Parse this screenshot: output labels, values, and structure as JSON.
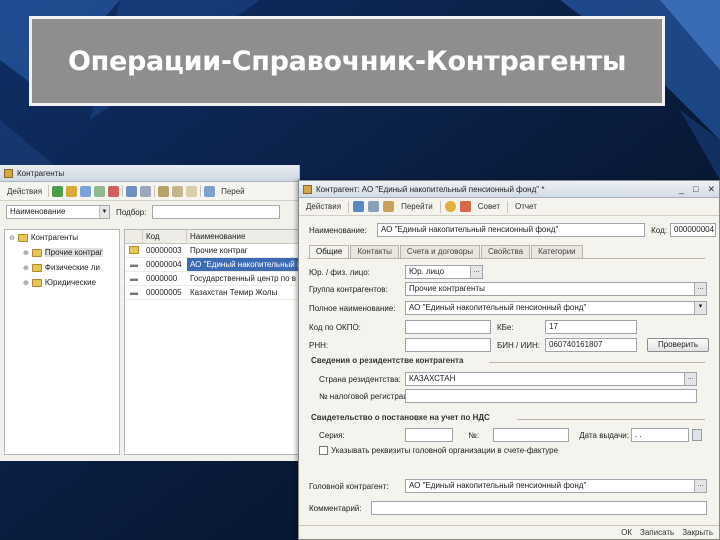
{
  "slide": {
    "title": "Операции-Справочник-Контрагенты"
  },
  "main_window": {
    "title": "Контрагенты",
    "toolbar": {
      "actions_label": "Действия",
      "goto_label": "Перей"
    },
    "filter": {
      "select_value": "Наименование",
      "label": "Подбор:"
    },
    "tree": {
      "items": [
        {
          "label": "Контрагенты"
        },
        {
          "label": "Прочие контраг"
        },
        {
          "label": "Физические ли"
        },
        {
          "label": "Юридические"
        }
      ]
    },
    "grid": {
      "headers": {
        "code": "Код",
        "name": "Наименование"
      },
      "rows": [
        {
          "code": "00000003",
          "name": "Прочие контраг"
        },
        {
          "code": "00000004",
          "name": "АО \"Единый накопительный пенсионный фонд\""
        },
        {
          "code": "0000000",
          "name": "Государственный центр по в"
        },
        {
          "code": "00000005",
          "name": "Казахстан Темир Жолы"
        }
      ]
    }
  },
  "dialog": {
    "title": "Контрагент: АО \"Единый накопительный пенсионный фонд\" *",
    "toolbar": {
      "actions_label": "Действия",
      "goto_label": "Перейти",
      "advice_label": "Совет",
      "report_label": "Отчет"
    },
    "name": {
      "label": "Наименование:",
      "value": "АО \"Единый накопительный пенсионный фонд\""
    },
    "code": {
      "label": "Код:",
      "value": "000000004"
    },
    "tabs": [
      "Общие",
      "Контакты",
      "Счета и договоры",
      "Свойства",
      "Категории"
    ],
    "fields": {
      "legal_type": {
        "label": "Юр. / физ. лицо:",
        "value": "Юр. лицо"
      },
      "group": {
        "label": "Группа контрагентов:",
        "value": "Прочие контрагенты"
      },
      "full_name": {
        "label": "Полное наименование:",
        "value": "АО \"Единый накопительный пенсионный фонд\""
      },
      "okpo": {
        "label": "Код по ОКПО:",
        "value": ""
      },
      "kbe": {
        "label": "КБе:",
        "value": "17"
      },
      "rnn": {
        "label": "РНН:",
        "value": ""
      },
      "bin": {
        "label": "БИН / ИИН:",
        "value": "060740161807"
      },
      "check_button": "Проверить",
      "residency_section": "Сведения о резидентстве контрагента",
      "country": {
        "label": "Страна резидентства:",
        "value": "КАЗАХСТАН"
      },
      "tax_reg": {
        "label": "№ налоговой регистрации:",
        "value": ""
      },
      "vat_section": "Свидетельство о постановке на учет по НДС",
      "series": {
        "label": "Серия:",
        "value": ""
      },
      "number": {
        "label": "№:",
        "value": ""
      },
      "date": {
        "label": "Дата выдачи:",
        "value": ". ."
      },
      "checkbox_label": "Указывать реквизиты головной организации в счете-фактуре",
      "head": {
        "label": "Головной контрагент:",
        "value": "АО \"Единый накопительный пенсионный фонд\""
      },
      "comment": {
        "label": "Комментарий:",
        "value": ""
      }
    },
    "status": {
      "ok": "ОК",
      "save": "Записать",
      "close": "Закрыть"
    }
  },
  "colors": {
    "background": "#0b1e3f",
    "title_box": "#8e8e8e",
    "selection": "#3d6bb3"
  }
}
